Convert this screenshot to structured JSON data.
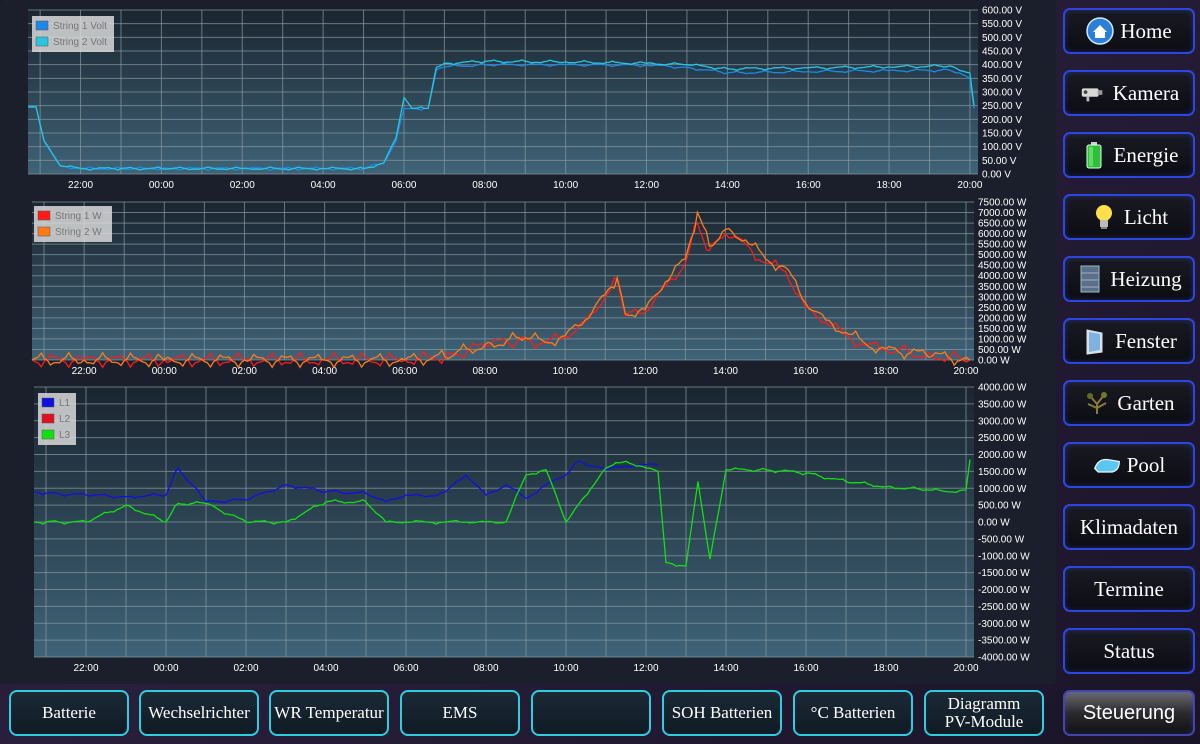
{
  "colors": {
    "nav_border": "#2d46e0",
    "tab_border": "#2ecde0",
    "grid": "#8a9aa0"
  },
  "nav": {
    "items": [
      {
        "label": "Home",
        "icon": "home-icon"
      },
      {
        "label": "Kamera",
        "icon": "camera-icon"
      },
      {
        "label": "Energie",
        "icon": "battery-icon"
      },
      {
        "label": "Licht",
        "icon": "lightbulb-icon"
      },
      {
        "label": "Heizung",
        "icon": "heater-icon"
      },
      {
        "label": "Fenster",
        "icon": "window-icon"
      },
      {
        "label": "Garten",
        "icon": "plant-icon"
      },
      {
        "label": "Pool",
        "icon": "pool-icon"
      },
      {
        "label": "Klimadaten",
        "icon": ""
      },
      {
        "label": "Termine",
        "icon": ""
      },
      {
        "label": "Status",
        "icon": ""
      },
      {
        "label": "Steuerung",
        "icon": ""
      }
    ]
  },
  "tabs": [
    "Batterie",
    "Wechselrichter",
    "WR Temperatur",
    "EMS",
    "",
    "SOH Batterien",
    "°C Batterien",
    "Diagramm\nPV-Module"
  ],
  "chart_data": [
    {
      "type": "line",
      "x_ticks": [
        "22:00",
        "00:00",
        "02:00",
        "04:00",
        "06:00",
        "08:00",
        "10:00",
        "12:00",
        "14:00",
        "16:00",
        "18:00",
        "20:00"
      ],
      "y_ticks": [
        "600.00 V",
        "550.00 V",
        "500.00 V",
        "450.00 V",
        "400.00 V",
        "350.00 V",
        "300.00 V",
        "250.00 V",
        "200.00 V",
        "150.00 V",
        "100.00 V",
        "50.00 V",
        "0.00 V"
      ],
      "ylim": [
        0,
        600
      ],
      "legend_position": "top-left",
      "x_hours": [
        20.7,
        20.9,
        21.1,
        21.5,
        22,
        23,
        0,
        2,
        4,
        5,
        5.5,
        5.8,
        6,
        6.2,
        6.5,
        6.6,
        6.8,
        7,
        8,
        10,
        12,
        13,
        14,
        16,
        18,
        19.5,
        20.0,
        20.1
      ],
      "series": [
        {
          "name": "String 1 Volt",
          "color": "#1e88e5",
          "values": [
            245,
            245,
            120,
            30,
            20,
            20,
            20,
            20,
            20,
            20,
            40,
            120,
            240,
            240,
            240,
            240,
            380,
            392,
            400,
            400,
            398,
            390,
            370,
            375,
            378,
            380,
            350,
            240
          ]
        },
        {
          "name": "String 2 Volt",
          "color": "#29c4e0",
          "values": [
            245,
            245,
            120,
            30,
            20,
            20,
            20,
            20,
            20,
            20,
            40,
            130,
            280,
            240,
            240,
            240,
            390,
            405,
            412,
            410,
            405,
            400,
            385,
            388,
            392,
            395,
            370,
            250
          ]
        }
      ]
    },
    {
      "type": "line",
      "x_ticks": [
        "22:00",
        "00:00",
        "02:00",
        "04:00",
        "06:00",
        "08:00",
        "10:00",
        "12:00",
        "14:00",
        "16:00",
        "18:00",
        "20:00"
      ],
      "y_ticks": [
        "7500.00 W",
        "7000.00 W",
        "6500.00 W",
        "6000.00 W",
        "5500.00 W",
        "5000.00 W",
        "4500.00 W",
        "4000.00 W",
        "3500.00 W",
        "3000.00 W",
        "2500.00 W",
        "2000.00 W",
        "1500.00 W",
        "1000.00 W",
        "500.00 W",
        "0.00 W"
      ],
      "ylim": [
        0,
        7500
      ],
      "legend_position": "top-left",
      "x_hours": [
        20.7,
        22,
        0,
        2,
        4,
        6,
        7,
        8,
        9,
        9.5,
        10,
        10.5,
        11,
        11.3,
        11.5,
        12,
        12.5,
        13,
        13.3,
        13.6,
        14,
        14.5,
        15,
        15.5,
        16,
        16.5,
        17,
        17.5,
        18,
        19,
        20.1
      ],
      "series": [
        {
          "name": "String 1 W",
          "color": "#ff1a1a",
          "values": [
            0,
            0,
            0,
            0,
            0,
            0,
            150,
            700,
            1000,
            800,
            1100,
            1800,
            3000,
            3800,
            2100,
            2300,
            3500,
            4600,
            6500,
            5200,
            6000,
            5500,
            4600,
            4200,
            2500,
            1800,
            1200,
            700,
            500,
            250,
            0
          ]
        },
        {
          "name": "String 2 W",
          "color": "#ff7b1a",
          "values": [
            0,
            0,
            0,
            0,
            0,
            0,
            160,
            720,
            1050,
            850,
            1150,
            1900,
            3100,
            3900,
            2200,
            2400,
            3700,
            4800,
            7000,
            5400,
            6200,
            5700,
            4800,
            4400,
            2700,
            1900,
            1300,
            750,
            520,
            260,
            0
          ]
        }
      ]
    },
    {
      "type": "line",
      "x_ticks": [
        "22:00",
        "00:00",
        "02:00",
        "04:00",
        "06:00",
        "08:00",
        "10:00",
        "12:00",
        "14:00",
        "16:00",
        "18:00",
        "20:00"
      ],
      "y_ticks": [
        "4000.00 W",
        "3500.00 W",
        "3000.00 W",
        "2500.00 W",
        "2000.00 W",
        "1500.00 W",
        "1000.00 W",
        "500.00 W",
        "0.00 W",
        "-500.00 W",
        "-1000.00 W",
        "-1500.00 W",
        "-2000.00 W",
        "-2500.00 W",
        "-3000.00 W",
        "-3500.00 W",
        "-4000.00 W"
      ],
      "ylim": [
        -4000,
        4000
      ],
      "legend_position": "top-left",
      "x_hours": [
        20.7,
        21,
        22,
        23,
        0,
        0.3,
        1,
        2,
        3,
        4,
        5,
        5.5,
        6,
        6.5,
        7,
        7.5,
        8,
        8.5,
        9,
        9.5,
        10,
        10.3,
        11,
        11.5,
        12,
        12.3,
        12.5,
        13,
        13.3,
        13.6,
        14,
        15,
        16,
        17,
        18,
        19,
        19.5,
        20.0,
        20.1
      ],
      "series": [
        {
          "name": "L1",
          "color": "#1010e0",
          "values": [
            900,
            850,
            800,
            750,
            800,
            1600,
            600,
            650,
            1100,
            900,
            850,
            600,
            800,
            750,
            900,
            1400,
            800,
            1100,
            700,
            1100,
            1400,
            1800,
            1550,
            1650,
            1700,
            1700,
            null,
            null,
            null,
            null,
            null,
            null,
            null,
            null,
            null,
            null,
            null,
            null,
            null
          ]
        },
        {
          "name": "L2",
          "color": "#e01020",
          "values": [
            null,
            null,
            null,
            null,
            null,
            null,
            null,
            null,
            null,
            null,
            null,
            null,
            null,
            null,
            null,
            null,
            null,
            null,
            null,
            null,
            null,
            null,
            null,
            null,
            null,
            null,
            null,
            null,
            null,
            null,
            null,
            null,
            null,
            null,
            null,
            null,
            null,
            null,
            null
          ]
        },
        {
          "name": "L3",
          "color": "#10e010",
          "values": [
            0,
            0,
            0,
            500,
            0,
            550,
            550,
            0,
            0,
            600,
            600,
            0,
            0,
            0,
            0,
            0,
            0,
            0,
            1400,
            1550,
            0,
            500,
            1600,
            1800,
            1600,
            1500,
            -1200,
            -1300,
            1200,
            -1100,
            1550,
            1550,
            1450,
            1200,
            1050,
            950,
            900,
            950,
            1850
          ]
        }
      ]
    }
  ]
}
